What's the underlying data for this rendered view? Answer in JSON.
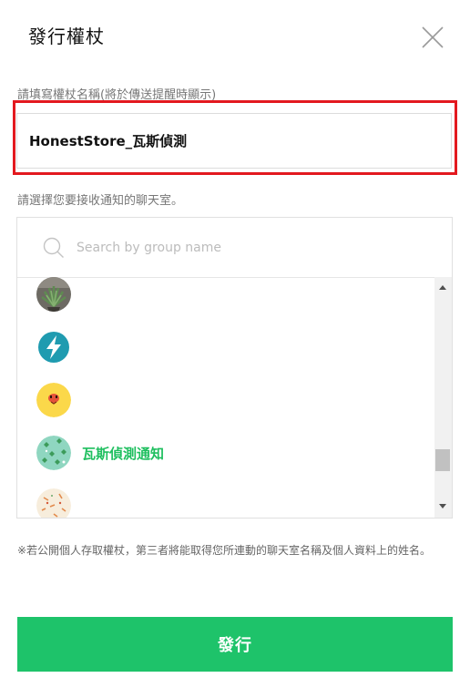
{
  "dialog": {
    "title": "發行權杖",
    "token_name_label": "請填寫權杖名稱(將於傳送提醒時顯示)",
    "token_name_value": "HonestStore_瓦斯偵測",
    "chat_select_label": "請選擇您要接收通知的聊天室。",
    "search_placeholder": "Search by group name",
    "notice": "※若公開個人存取權杖，第三者將能取得您所連動的聊天室名稱及個人資料上的姓名。",
    "issue_button_label": "發行"
  },
  "groups": [
    {
      "label": "",
      "avatar": "plant-photo"
    },
    {
      "label": "",
      "avatar": "lightning-bolt-icon"
    },
    {
      "label": "",
      "avatar": "yellow-chick-character"
    },
    {
      "label": "瓦斯偵測通知",
      "avatar": "teal-leaf-pattern"
    },
    {
      "label": "",
      "avatar": "cream-pattern"
    }
  ],
  "colors": {
    "accent_green": "#1ec36a",
    "highlight_red": "#e3191f",
    "selected_label": "#1fbf5f"
  }
}
